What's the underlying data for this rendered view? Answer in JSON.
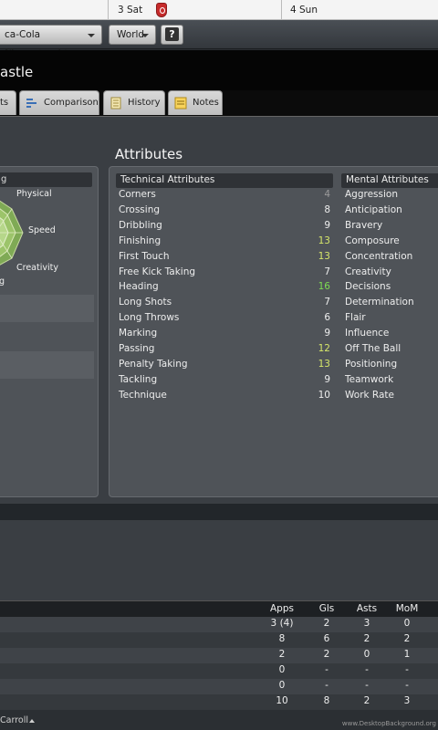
{
  "datebar": {
    "day3": "3 Sat",
    "day4": "4 Sun"
  },
  "toolbar": {
    "competition": "ca-Cola Championship",
    "region": "World",
    "help": "?"
  },
  "title": {
    "name": "astle"
  },
  "tabs": [
    {
      "label": "ts"
    },
    {
      "label": "Comparison"
    },
    {
      "label": "History"
    },
    {
      "label": "Notes"
    }
  ],
  "section_title": "Attributes",
  "left_panel": {
    "header": "g",
    "radar": [
      "Physical",
      "Speed",
      "Creativity"
    ],
    "extra_label": "g"
  },
  "technical": {
    "header": "Technical Attributes",
    "rows": [
      {
        "name": "Corners",
        "value": "4",
        "tier": "lo"
      },
      {
        "name": "Crossing",
        "value": "8",
        "tier": ""
      },
      {
        "name": "Dribbling",
        "value": "9",
        "tier": ""
      },
      {
        "name": "Finishing",
        "value": "13",
        "tier": "hi"
      },
      {
        "name": "First Touch",
        "value": "13",
        "tier": "hi"
      },
      {
        "name": "Free Kick Taking",
        "value": "7",
        "tier": ""
      },
      {
        "name": "Heading",
        "value": "16",
        "tier": "vhi"
      },
      {
        "name": "Long Shots",
        "value": "7",
        "tier": ""
      },
      {
        "name": "Long Throws",
        "value": "6",
        "tier": ""
      },
      {
        "name": "Marking",
        "value": "9",
        "tier": ""
      },
      {
        "name": "Passing",
        "value": "12",
        "tier": "hi"
      },
      {
        "name": "Penalty Taking",
        "value": "13",
        "tier": "hi"
      },
      {
        "name": "Tackling",
        "value": "9",
        "tier": ""
      },
      {
        "name": "Technique",
        "value": "10",
        "tier": ""
      }
    ]
  },
  "mental": {
    "header": "Mental Attributes",
    "rows": [
      "Aggression",
      "Anticipation",
      "Bravery",
      "Composure",
      "Concentration",
      "Creativity",
      "Decisions",
      "Determination",
      "Flair",
      "Influence",
      "Off The Ball",
      "Positioning",
      "Teamwork",
      "Work Rate"
    ]
  },
  "stats": {
    "headers": [
      "Apps",
      "Gls",
      "Asts",
      "MoM"
    ],
    "rows": [
      [
        "3 (4)",
        "2",
        "3",
        "0"
      ],
      [
        "8",
        "6",
        "2",
        "2"
      ],
      [
        "2",
        "2",
        "0",
        "1"
      ],
      [
        "0",
        "-",
        "-",
        "-"
      ],
      [
        "0",
        "-",
        "-",
        "-"
      ],
      [
        "10",
        "8",
        "2",
        "3"
      ]
    ]
  },
  "footer": {
    "player": "Carroll"
  },
  "watermark": "www.DesktopBackground.org"
}
